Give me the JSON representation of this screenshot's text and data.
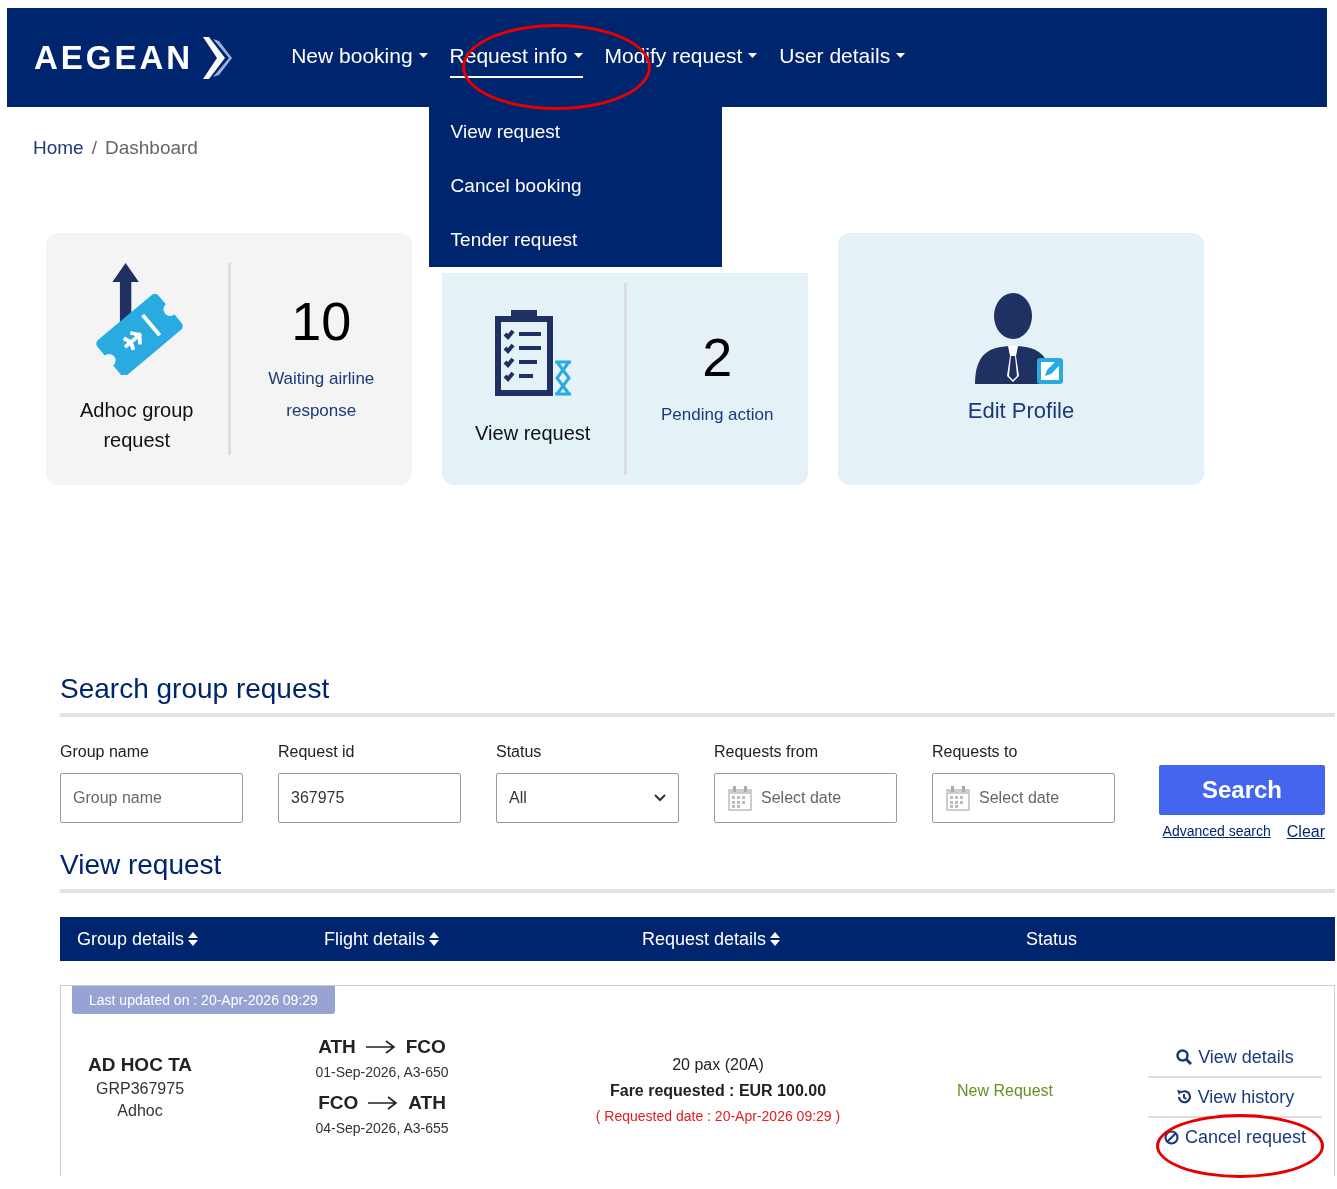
{
  "header": {
    "brand": "AEGEAN",
    "nav": [
      {
        "label": "New booking",
        "selected": false,
        "circled": false
      },
      {
        "label": "Request info",
        "selected": true,
        "circled": true
      },
      {
        "label": "Modify request",
        "selected": false,
        "circled": false
      },
      {
        "label": "User details",
        "selected": false,
        "circled": false
      }
    ],
    "dropdown": [
      "View request",
      "Cancel booking",
      "Tender request"
    ]
  },
  "breadcrumb": {
    "separator": "/",
    "items": [
      {
        "label": "Home",
        "current": false
      },
      {
        "label": "Dashboard",
        "current": true
      }
    ]
  },
  "cards": [
    {
      "kind": "booking",
      "label": "Adhoc group request",
      "count": "10",
      "count_label": "Waiting airline response"
    },
    {
      "kind": "requests",
      "label": "View request",
      "count": "2",
      "count_label": "Pending action"
    },
    {
      "kind": "profile",
      "label": "Edit Profile"
    }
  ],
  "search": {
    "title": "Search group request",
    "fields": [
      {
        "kind": "text",
        "label": "Group name",
        "placeholder": "Group name"
      },
      {
        "kind": "text",
        "label": "Request id",
        "value": "367975"
      },
      {
        "kind": "select",
        "label": "Status",
        "value": "All"
      },
      {
        "kind": "date",
        "label": "Requests from",
        "placeholder": "Select date"
      },
      {
        "kind": "date",
        "label": "Requests to",
        "placeholder": "Select date"
      }
    ],
    "button": "Search",
    "links": [
      "Advanced search",
      "Clear"
    ]
  },
  "results": {
    "title": "View request",
    "columns": [
      {
        "label": "Group details",
        "sortable": true
      },
      {
        "label": "Flight details",
        "sortable": true
      },
      {
        "label": "Request details",
        "sortable": true
      },
      {
        "label": "Status",
        "sortable": false
      }
    ],
    "rows": [
      {
        "updated": "Last updated on : 20-Apr-2026 09:29",
        "group_name": "AD HOC TA",
        "group_code": "GRP367975",
        "group_type": "Adhoc",
        "flights": [
          {
            "from": "ATH",
            "to": "FCO",
            "detail": "01-Sep-2026, A3-650"
          },
          {
            "from": "FCO",
            "to": "ATH",
            "detail": "04-Sep-2026, A3-655"
          }
        ],
        "pax": "20 pax (20A)",
        "fare": "Fare requested : EUR 100.00",
        "requested_date": "( Requested date : 20-Apr-2026 09:29 )",
        "status": "New Request",
        "actions": [
          {
            "kind": "details",
            "label": "View details",
            "circled": false
          },
          {
            "kind": "history",
            "label": "View history",
            "circled": false
          },
          {
            "kind": "cancel",
            "label": "Cancel request",
            "circled": true
          }
        ]
      }
    ]
  }
}
